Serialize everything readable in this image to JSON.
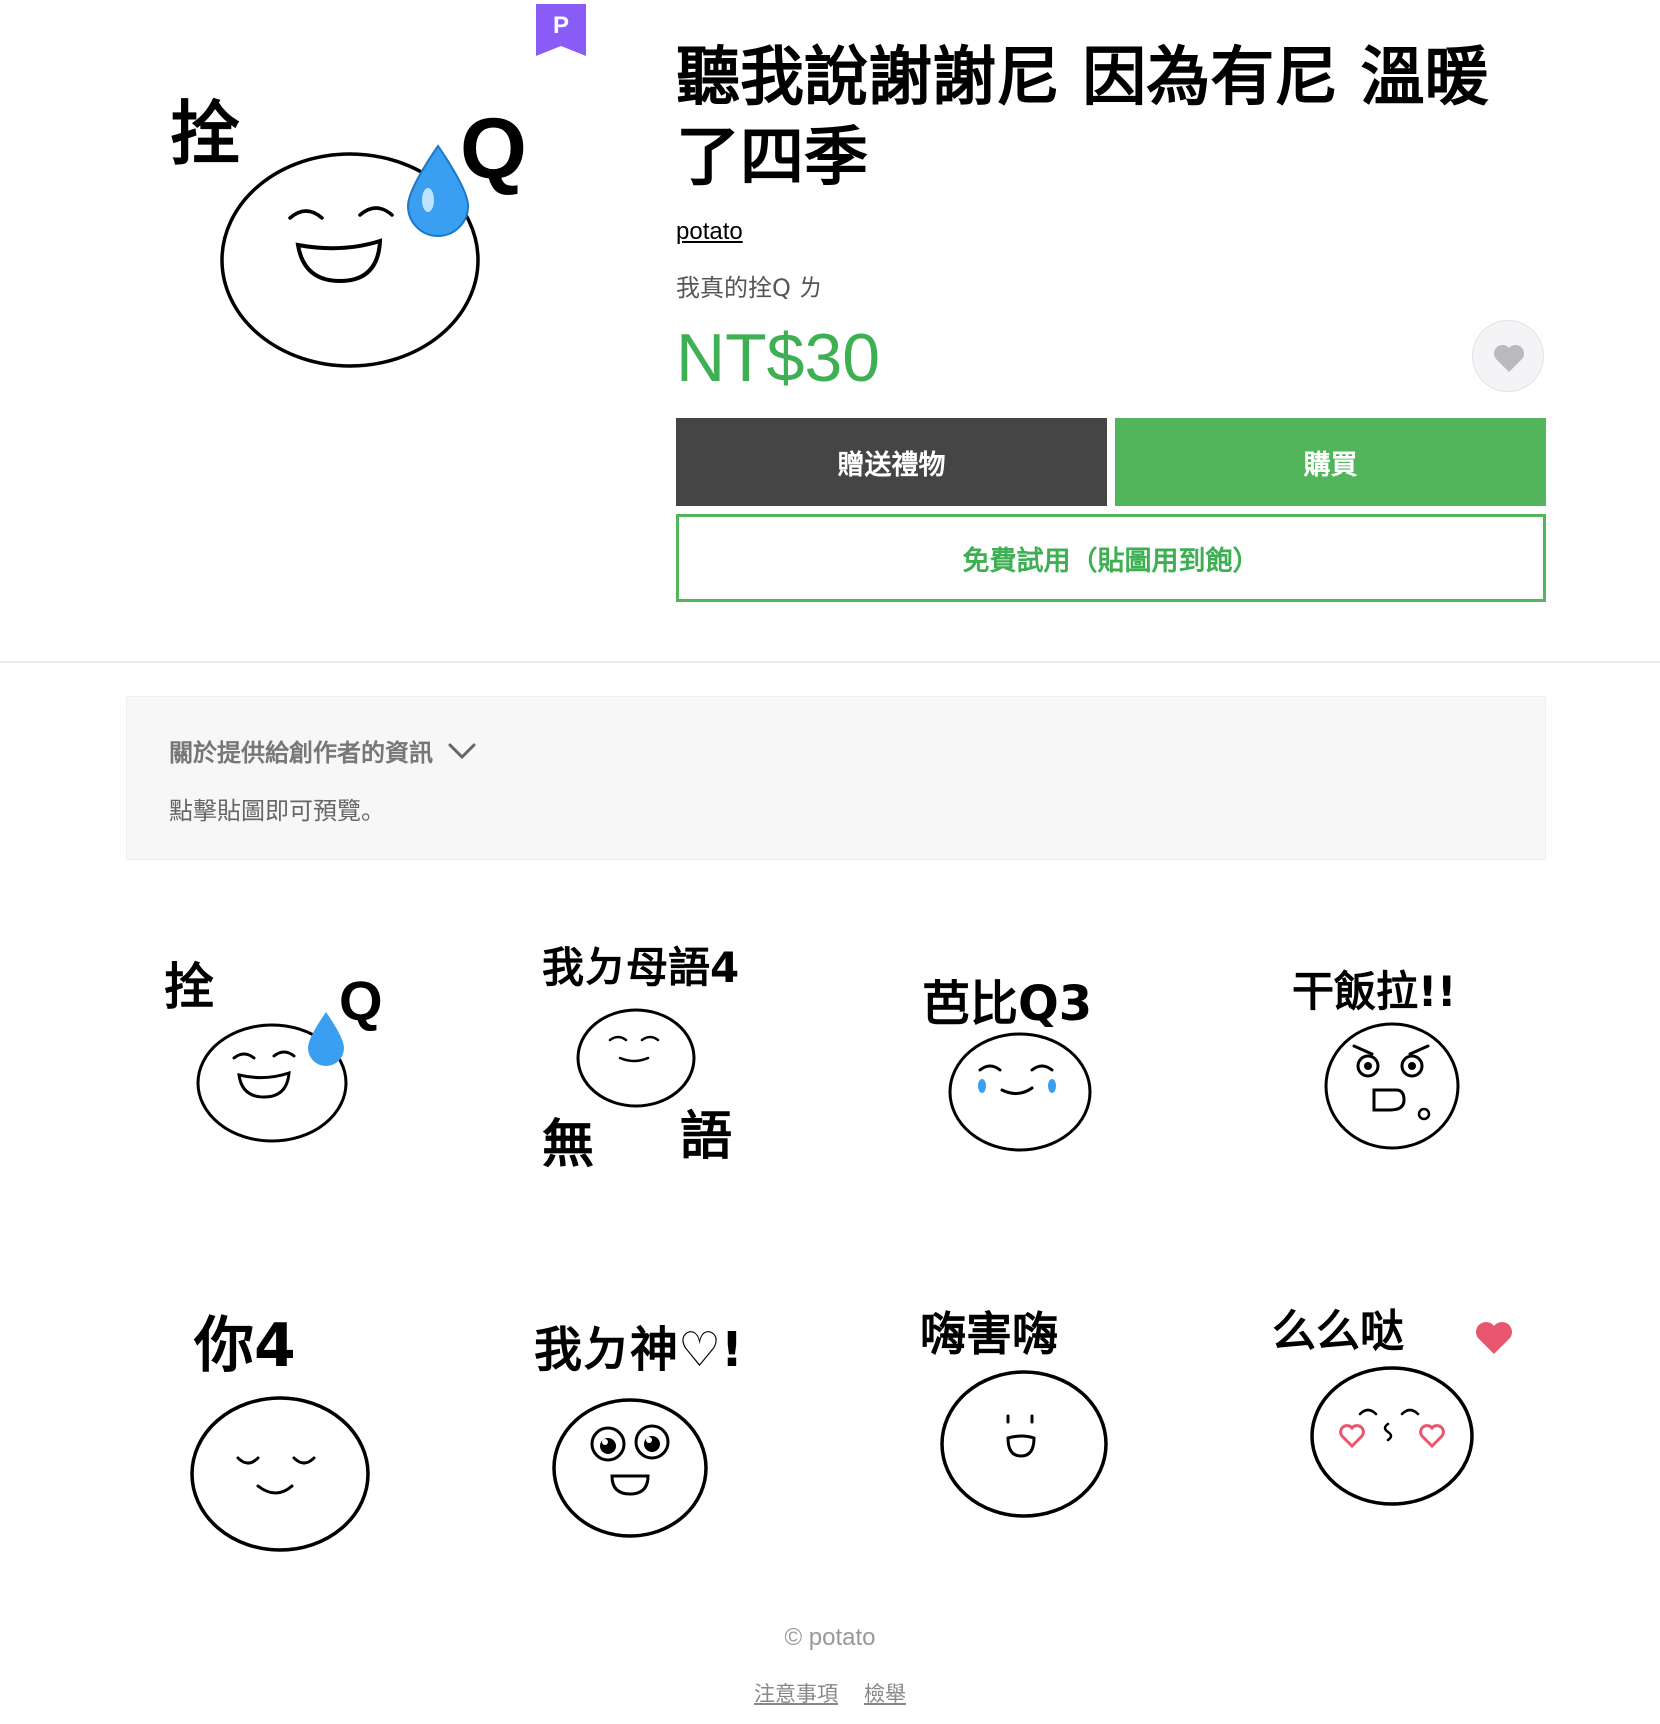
{
  "product": {
    "premium_badge": "P",
    "title": "聽我說謝謝尼 因為有尼 溫暖了四季",
    "author": "potato",
    "description": "我真的拴Q ㄌ",
    "price": "NT$30",
    "favorite_icon": "heart-icon",
    "gift_label": "贈送禮物",
    "buy_label": "購買",
    "trial_label": "免費試用（貼圖用到飽）",
    "main_sticker": {
      "text_left": "拴",
      "text_right": "Q"
    }
  },
  "info": {
    "title": "關於提供給創作者的資訊",
    "hint": "點擊貼圖即可預覽。"
  },
  "stickers": [
    {
      "top": "拴",
      "top2": "Q"
    },
    {
      "top": "我ㄉ母語4",
      "bottom_left": "無",
      "bottom_right": "語"
    },
    {
      "top": "芭比Q3"
    },
    {
      "top": "干飯拉!!"
    },
    {
      "top": "你4"
    },
    {
      "top": "我ㄉ神♡!"
    },
    {
      "top": "嗨害嗨"
    },
    {
      "top": "么么哒"
    }
  ],
  "colors": {
    "accent_green": "#52b45b",
    "price_green": "#3faf53",
    "gift_dark": "#454545",
    "premium_purple": "#8a5cf6",
    "drop_blue": "#3a9ff0"
  },
  "footer": {
    "copyright": "© potato",
    "links": [
      "注意事項",
      "檢舉"
    ]
  }
}
